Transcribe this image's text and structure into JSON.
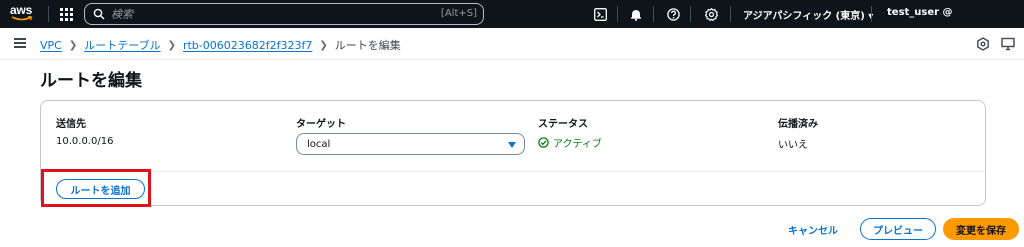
{
  "topnav": {
    "logo_text": "aws",
    "search": {
      "placeholder": "検索",
      "shortcut": "[Alt+S]"
    },
    "region_label": "アジアパシフィック (東京) ▾",
    "user_label": "test_user @",
    "icons": [
      "services-grid-icon",
      "search-icon",
      "cloudshell-icon",
      "notifications-bell-icon",
      "help-icon",
      "settings-gear-icon"
    ]
  },
  "breadcrumb": {
    "items": [
      "VPC",
      "ルートテーブル",
      "rtb-006023682f2f323f7"
    ],
    "current": "ルートを編集"
  },
  "page": {
    "title": "ルートを編集"
  },
  "routes_table": {
    "columns": [
      "送信先",
      "ターゲット",
      "ステータス",
      "伝播済み"
    ],
    "rows": [
      {
        "destination": "10.0.0.0/16",
        "target": "local",
        "status": "アクティブ",
        "propagated": "いいえ"
      }
    ]
  },
  "buttons": {
    "add_route": "ルートを追加",
    "cancel": "キャンセル",
    "preview": "プレビュー",
    "save": "変更を保存"
  },
  "colors": {
    "nav_bg": "#0f141a",
    "link": "#0972d3",
    "status_ok": "#037f0c",
    "primary": "#ff9900",
    "highlight": "#e0121b"
  }
}
